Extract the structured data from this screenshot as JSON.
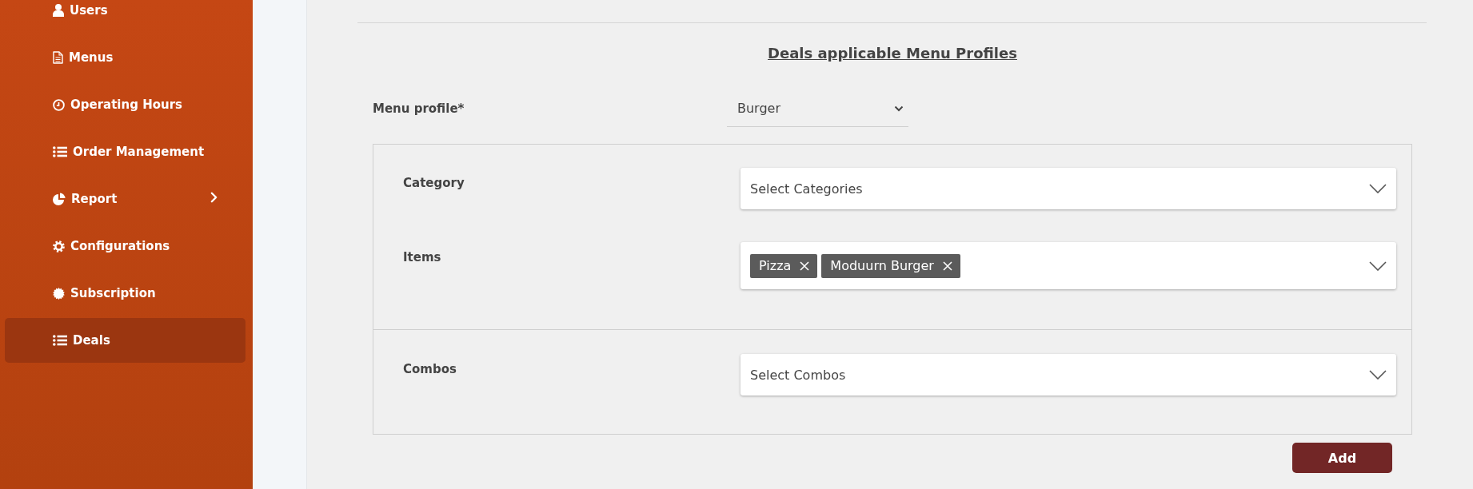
{
  "sidebar": {
    "items": [
      {
        "label": "Users",
        "selected": false,
        "expandable": false
      },
      {
        "label": "Menus",
        "selected": false,
        "expandable": false
      },
      {
        "label": "Operating Hours",
        "selected": false,
        "expandable": false
      },
      {
        "label": "Order Management",
        "selected": false,
        "expandable": false
      },
      {
        "label": "Report",
        "selected": false,
        "expandable": true
      },
      {
        "label": "Configurations",
        "selected": false,
        "expandable": false
      },
      {
        "label": "Subscription",
        "selected": false,
        "expandable": false
      },
      {
        "label": "Deals",
        "selected": true,
        "expandable": false
      }
    ]
  },
  "content": {
    "heading": "Deals applicable Menu Profiles",
    "menu_profile": {
      "label": "Menu profile*",
      "value": "Burger"
    },
    "sections": [
      {
        "fields": [
          {
            "label": "Category",
            "placeholder": "Select Categories"
          },
          {
            "label": "Items",
            "tags": [
              "Pizza",
              "Moduurn Burger"
            ]
          }
        ]
      },
      {
        "fields": [
          {
            "label": "Combos",
            "placeholder": "Select Combos"
          }
        ]
      }
    ],
    "buttons": [
      {
        "label": "Add"
      }
    ]
  }
}
